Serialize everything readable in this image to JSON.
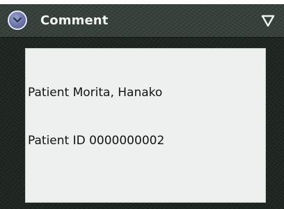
{
  "panel": {
    "title": "Comment",
    "collapse_icon": "chevron-down-circle-icon",
    "menu_icon": "triangle-down-outline-icon"
  },
  "comment": {
    "lines": [
      "Patient Morita, Hanako",
      "Patient ID 0000000002"
    ]
  },
  "colors": {
    "panel_background": "#1f2622",
    "header_background": "#37403a",
    "text_area_background": "#eef0ef",
    "collapse_button": "#6c74a8",
    "title_text": "#f2f4f2"
  }
}
